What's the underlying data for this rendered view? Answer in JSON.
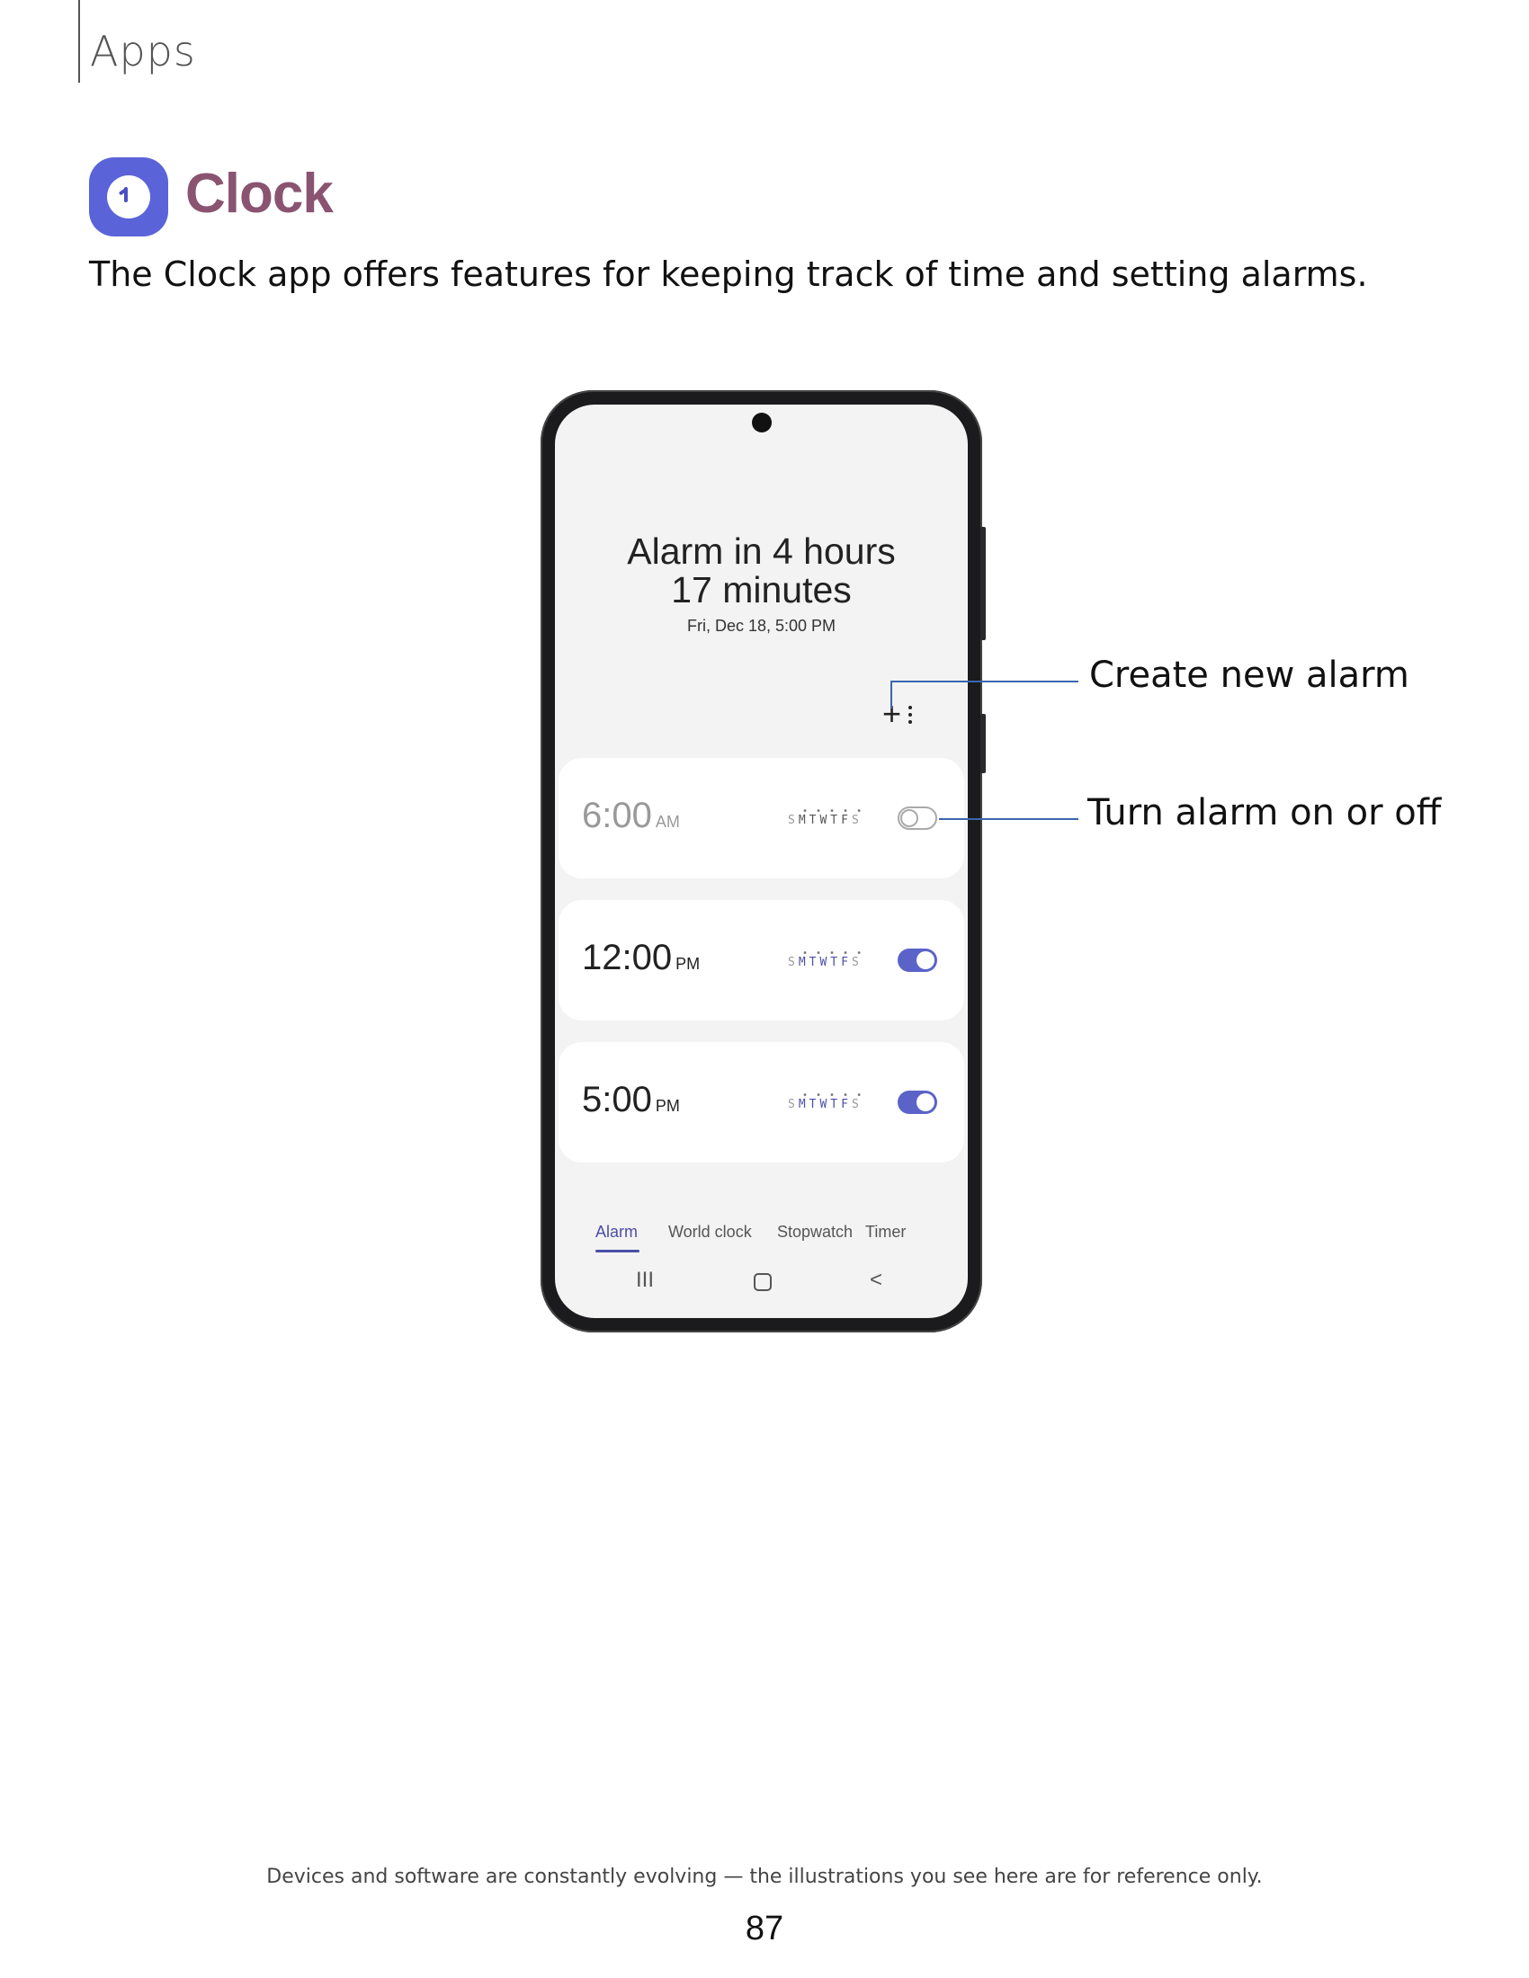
{
  "header": {
    "section": "Apps"
  },
  "app": {
    "title": "Clock",
    "icon": "clock-icon",
    "intro": "The Clock app offers features for keeping track of time and setting alarms."
  },
  "phone": {
    "headline_line1": "Alarm in 4 hours",
    "headline_line2": "17 minutes",
    "next_alarm": "Fri, Dec 18, 5:00 PM",
    "add_symbol": "+",
    "alarms": [
      {
        "time": "6:00",
        "period": "AM",
        "days_first": "S",
        "days_week": "MTWTF",
        "days_last": "S",
        "enabled": false
      },
      {
        "time": "12:00",
        "period": "PM",
        "days_first": "S",
        "days_week": "MTWTF",
        "days_last": "S",
        "enabled": true
      },
      {
        "time": "5:00",
        "period": "PM",
        "days_first": "S",
        "days_week": "MTWTF",
        "days_last": "S",
        "enabled": true
      }
    ],
    "tabs": [
      "Alarm",
      "World clock",
      "Stopwatch",
      "Timer"
    ],
    "nav": {
      "recents": "III",
      "back": "<"
    }
  },
  "callouts": {
    "create": "Create new alarm",
    "toggle": "Turn alarm on or off"
  },
  "colors": {
    "accent": "#4b4fa8",
    "title": "#8a5471",
    "icon_bg": "#5b63d9",
    "callout_line": "#3a66b0"
  },
  "footer": {
    "disclaimer": "Devices and software are constantly evolving — the illustrations you see here are for reference only.",
    "page": "87"
  }
}
